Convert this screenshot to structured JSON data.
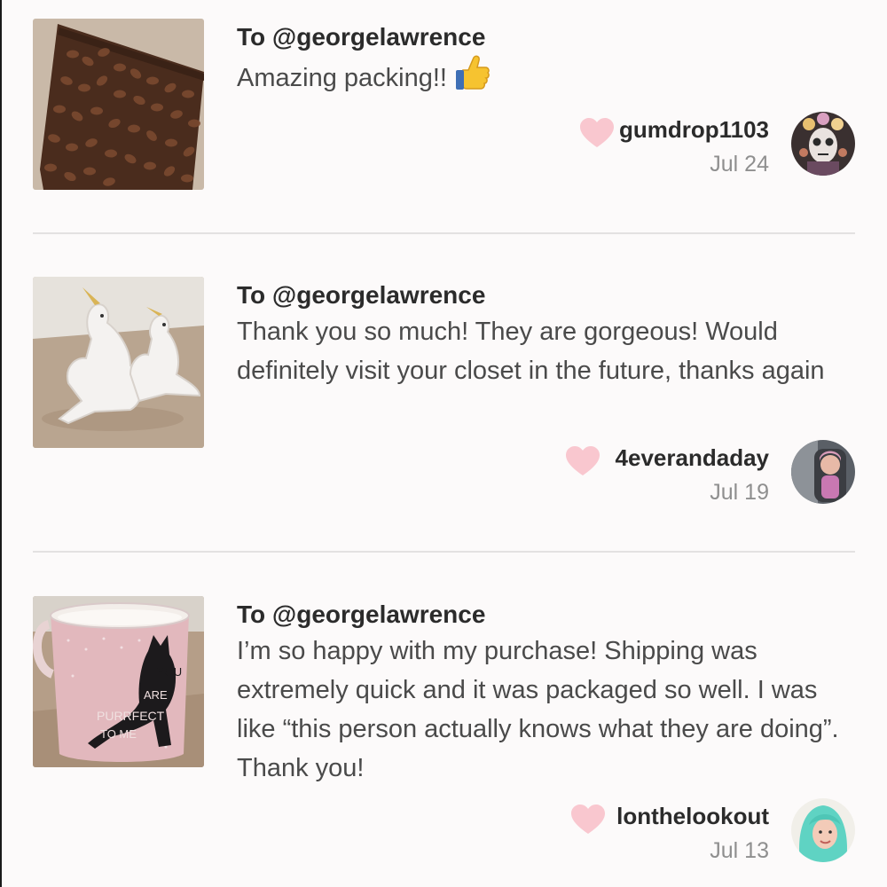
{
  "feed": {
    "reviews": [
      {
        "to": "To @georgelawrence",
        "message": "Amazing packing!!",
        "emoji": "thumbs-up-icon",
        "username": "gumdrop1103",
        "date": "Jul 24",
        "thumbnail": "coffee-beans-tray",
        "avatar": "sugar-skull-avatar"
      },
      {
        "to": "To @georgelawrence",
        "message": "Thank you so much! They are gorgeous! Would definitely visit your closet in the future, thanks again",
        "username": "4everandaday",
        "date": "Jul 19",
        "thumbnail": "unicorn-figurines",
        "avatar": "child-in-car-seat-avatar"
      },
      {
        "to": "To @georgelawrence",
        "message": "I’m so happy with my purchase! Shipping was extremely quick and it was packaged so well. I was like “this person actually knows what they are doing”. Thank you!",
        "username": "lonthelookout",
        "date": "Jul 13",
        "thumbnail": "cat-mug",
        "mug_text": [
          "YOU",
          "ARE",
          "PURRFECT",
          "TO ME"
        ],
        "avatar": "teal-hair-avatar"
      }
    ]
  },
  "colors": {
    "heart": "#f9c7cf",
    "divider": "#e3e1e1",
    "date": "#8f8f8f",
    "background": "#fcfafa"
  }
}
